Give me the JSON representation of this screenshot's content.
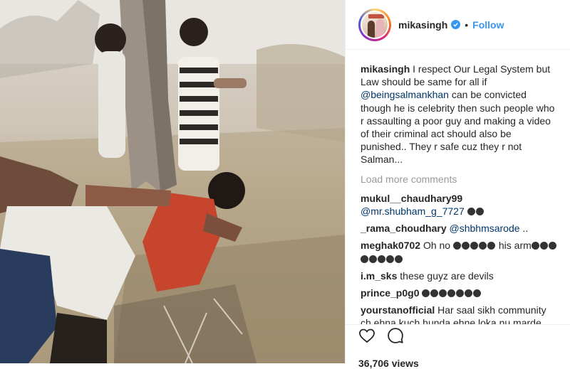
{
  "header": {
    "username": "mikasingh",
    "separator": "•",
    "follow_label": "Follow"
  },
  "caption": {
    "user": "mikasingh",
    "text_before": "I respect Our Legal System but Law should be same for all if ",
    "mention": "@beingsalmankhan",
    "text_after": " can be convicted though he is celebrity then such people who r assaulting a poor guy and making a video of their criminal act should also be punished.. They r safe cuz they r not Salman..."
  },
  "load_more": "Load more comments",
  "comments": [
    {
      "user": "mukul__chaudhary99",
      "mention": "@mr.shubham_g_7727",
      "text": "",
      "emoji_count": 2
    },
    {
      "user": "_rama_choudhary",
      "mention": "@shbhmsarode",
      "text": " ..",
      "emoji_count": 0
    },
    {
      "user": "meghak0702",
      "mention": "",
      "text": "Oh no",
      "emoji_count": 5,
      "text_2": "his arm",
      "emoji_count_2": 8
    },
    {
      "user": "i.m_sks",
      "mention": "",
      "text": "these guyz are devils",
      "emoji_count": 0
    },
    {
      "user": "prince_p0g0",
      "mention": "",
      "text": "",
      "emoji_count": 7
    },
    {
      "user": "yourstanofficial",
      "mention": "",
      "text": "Har saal sikh community ch ehna kuch hunda ehne loka nu marde aa.",
      "emoji_count": 0
    }
  ],
  "actions": {
    "like_icon": "heart-icon",
    "comment_icon": "speech-bubble-icon",
    "views": "36,706 views"
  },
  "colors": {
    "link_blue": "#3897f0",
    "mention_blue": "#003569",
    "muted_gray": "#999999"
  }
}
